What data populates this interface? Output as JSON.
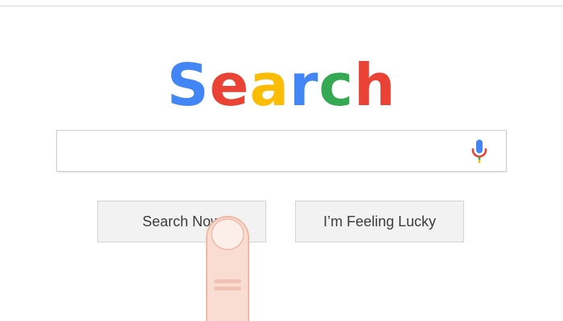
{
  "logo": {
    "letters": [
      "S",
      "e",
      "a",
      "r",
      "c",
      "h"
    ],
    "colors": [
      "#4285f4",
      "#ea4335",
      "#fbbc05",
      "#4285f4",
      "#34a853",
      "#ea4335"
    ]
  },
  "search": {
    "value": "",
    "placeholder": ""
  },
  "voice": {
    "icon": "microphone-icon",
    "colors": {
      "body": "#4285f4",
      "stand": "#ea4335",
      "base": "#34a853",
      "base_right": "#fbbc05"
    }
  },
  "buttons": {
    "search_label": "Search Now",
    "lucky_label": "I’m Feeling Lucky"
  },
  "pointer": {
    "icon": "finger-tap-icon",
    "color": "#f9ddd3"
  }
}
